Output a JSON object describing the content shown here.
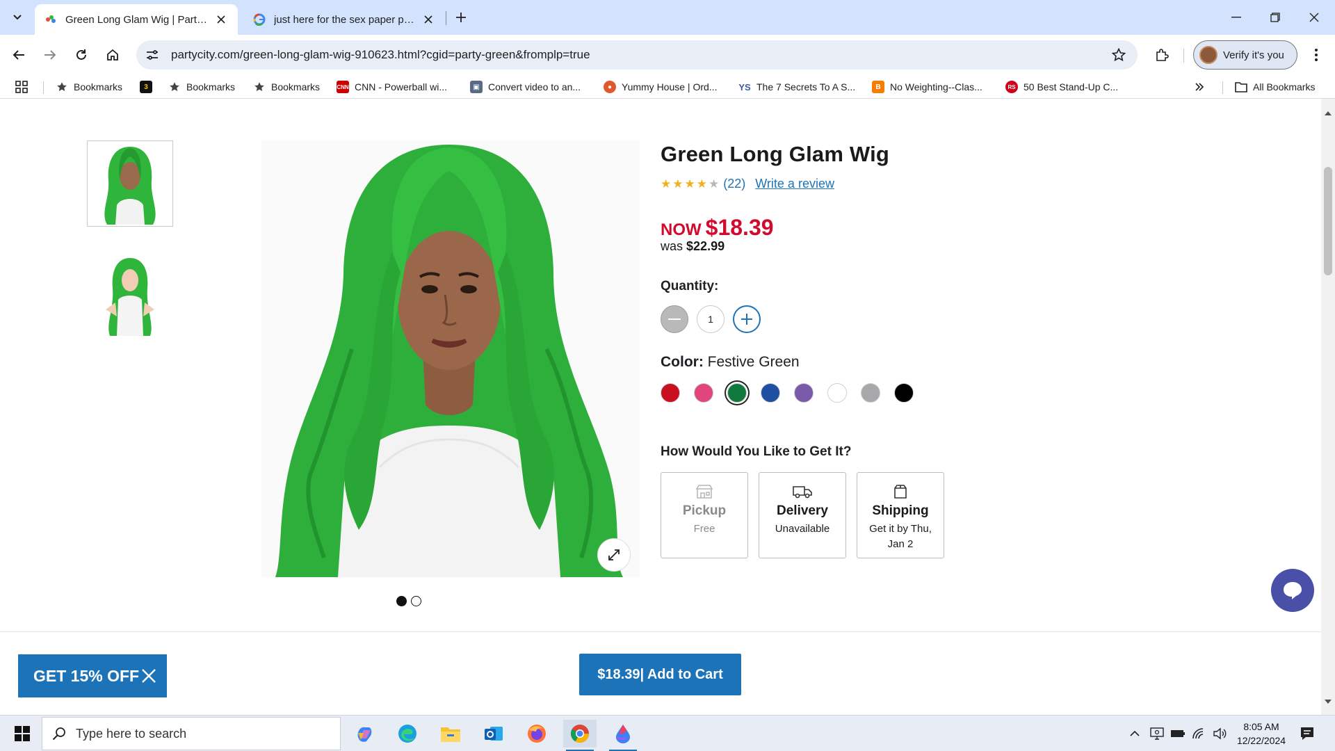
{
  "browser": {
    "tabs": [
      {
        "title": "Green Long Glam Wig | Party City",
        "active": true
      },
      {
        "title": "just here for the sex paper plates",
        "active": false
      }
    ],
    "url": "partycity.com/green-long-glam-wig-910623.html?cgid=party-green&fromplp=true",
    "verify_label": "Verify it's you",
    "bookmarks": [
      {
        "label": "Bookmarks",
        "icon": "star-icon"
      },
      {
        "label": "",
        "icon": "app-icon"
      },
      {
        "label": "Bookmarks",
        "icon": "star-icon"
      },
      {
        "label": "Bookmarks",
        "icon": "star-icon"
      },
      {
        "label": "CNN - Powerball wi...",
        "icon": "cnn-icon"
      },
      {
        "label": "Convert video to an...",
        "icon": "convert-icon"
      },
      {
        "label": "Yummy House | Ord...",
        "icon": "yummy-icon"
      },
      {
        "label": "The 7 Secrets To A S...",
        "icon": "ys-icon"
      },
      {
        "label": "No Weighting--Clas...",
        "icon": "blogger-icon"
      },
      {
        "label": "50 Best Stand-Up C...",
        "icon": "rs-icon"
      }
    ],
    "all_bookmarks_label": "All Bookmarks"
  },
  "product": {
    "title": "Green Long Glam Wig",
    "rating": 4,
    "rating_max": 5,
    "rating_count": "(22)",
    "write_review": "Write a review",
    "now_label": "NOW",
    "now_price": "$18.39",
    "was_label": "was",
    "was_price": "$22.99",
    "quantity_label": "Quantity:",
    "quantity_value": "1",
    "color_label": "Color:",
    "color_value": "Festive Green",
    "colors": [
      "#c8101e",
      "#e0457b",
      "#0f7a3c",
      "#1f4fa0",
      "#7a5aa8",
      "#ffffff",
      "#a8a8ab",
      "#000000"
    ],
    "selected_color_index": 2,
    "fulfillment_title": "How Would You Like to Get It?",
    "fulfillment_options": [
      {
        "title": "Pickup",
        "sub": "Free",
        "icon": "store-icon",
        "disabled": true
      },
      {
        "title": "Delivery",
        "sub": "Unavailable",
        "icon": "truck-icon",
        "disabled": false
      },
      {
        "title": "Shipping",
        "sub": "Get it by Thu, Jan 2",
        "icon": "box-icon",
        "disabled": false
      }
    ],
    "image_count": 2,
    "current_image": 1
  },
  "sticky": {
    "promo_label": "GET 15% OFF",
    "add_to_cart": "$18.39| Add to Cart"
  },
  "taskbar": {
    "search_placeholder": "Type here to search",
    "time": "8:05 AM",
    "date": "12/22/2024"
  },
  "colors": {
    "brand_blue": "#1c73b8",
    "price_red": "#d20a2e",
    "tab_strip": "#d3e3fd",
    "wig_green": "#2fb53c"
  }
}
